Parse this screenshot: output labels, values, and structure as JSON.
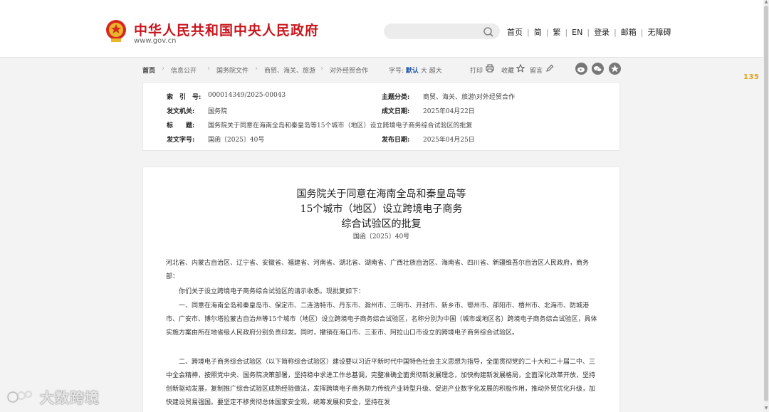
{
  "header": {
    "site_title": "中华人民共和国中央人民政府",
    "site_url": "www.gov.cn",
    "search_placeholder": "",
    "nav": [
      "首页",
      "简",
      "繁",
      "EN",
      "登录",
      "邮箱",
      "无障碍"
    ]
  },
  "breadcrumb": [
    "首页",
    "信息公开",
    "国务院文件",
    "商贸、海关、旅游",
    "对外经贸合作"
  ],
  "font_size": {
    "label": "字号:",
    "default": "默认",
    "large": "大",
    "xlarge": "超大"
  },
  "tools": {
    "print": "打印",
    "favorite": "收藏",
    "comment": "留言"
  },
  "right_badge": "135",
  "meta": {
    "index_label": "索　引　号:",
    "index_value": "000014349/2025-00043",
    "subject_label": "主题分类:",
    "subject_value": "商贸、海关、旅游\\对外经贸合作",
    "issuer_label": "发文机关:",
    "issuer_value": "国务院",
    "created_label": "成文日期:",
    "created_value": "2025年04月22日",
    "title_label": "标　　题:",
    "title_value": "国务院关于同意在海南全岛和秦皇岛等15个城市（地区）设立跨境电子商务综合试验区的批复",
    "docno_label": "发文字号:",
    "docno_value": "国函〔2025〕40号",
    "published_label": "发布日期:",
    "published_value": "2025年04月25日"
  },
  "document": {
    "title_lines": [
      "国务院关于同意在海南全岛和秦皇岛等",
      "15个城市（地区）设立跨境电子商务",
      "综合试验区的批复"
    ],
    "doc_number": "国函〔2025〕40号",
    "paragraphs": [
      "河北省、内蒙古自治区、辽宁省、安徽省、福建省、河南省、湖北省、湖南省、广西壮族自治区、海南省、四川省、新疆维吾尔自治区人民政府，商务部：",
      "你们关于设立跨境电子商务综合试验区的请示收悉。现批复如下：",
      "一、同意在海南全岛和秦皇岛市、保定市、二连浩特市、丹东市、滁州市、三明市、开封市、新乡市、鄂州市、邵阳市、梧州市、北海市、防城港市、广安市、博尔塔拉蒙古自治州等15个城市（地区）设立跨境电子商务综合试验区，名称分别为中国（城市或地区名）跨境电子商务综合试验区，具体实施方案由所在地省级人民政府分别负责印发。同时，撤销在海口市、三亚市、阿拉山口市设立的跨境电子商务综合试验区。",
      "二、跨境电子商务综合试验区（以下简称综合试验区）建设要以习近平新时代中国特色社会主义思想为指导，全面贯彻党的二十大和二十届二中、三中全会精神，按照党中央、国务院决策部署，坚持稳中求进工作总基调，完整准确全面贯彻新发展理念，加快构建新发展格局，全面深化改革开放，坚持创新驱动发展，复制推广综合试验区成熟经验做法，发挥跨境电子商务助力传统产业转型升级、促进产业数字化发展的积极作用，推动外贸优化升级，加快建设贸易强国。要坚定不移贯彻总体国家安全观，统筹发展和安全，坚持在发"
    ]
  },
  "watermark": "大数跨境",
  "colors": {
    "brand_red": "#c8161d",
    "link_blue": "#2b5aa8"
  }
}
